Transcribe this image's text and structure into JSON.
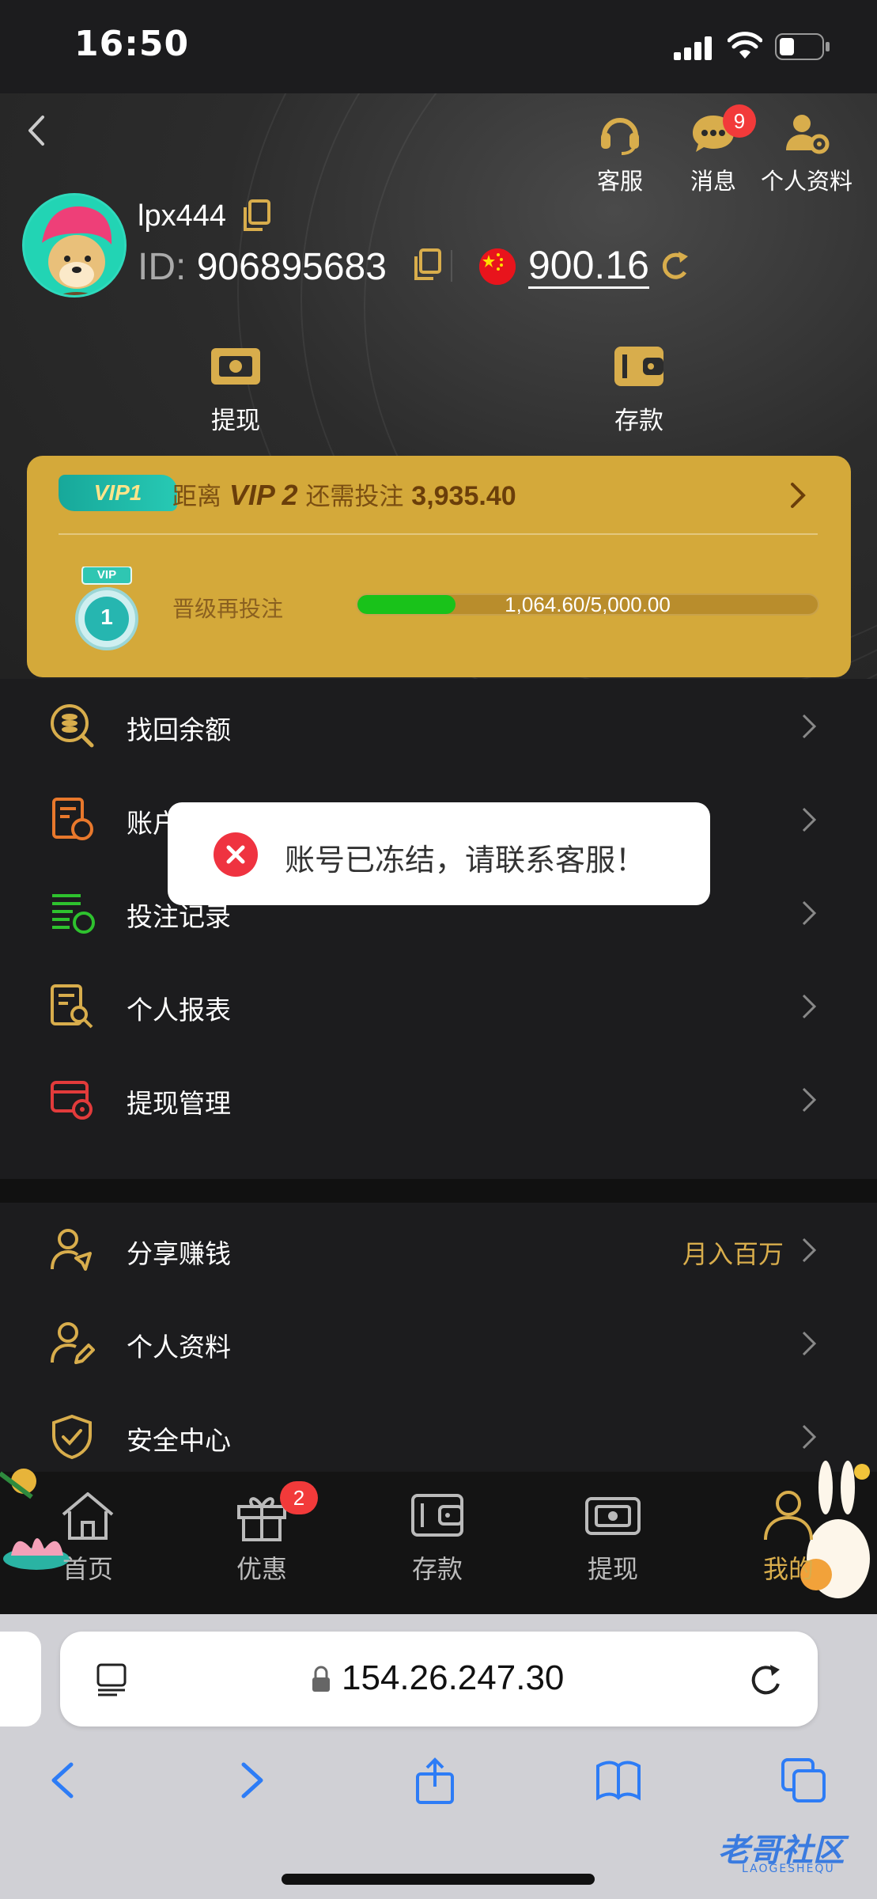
{
  "status": {
    "time": "16:50"
  },
  "header": {
    "actions": [
      {
        "label": "客服",
        "icon": "headset-icon"
      },
      {
        "label": "消息",
        "icon": "chat-icon",
        "badge": "9"
      },
      {
        "label": "个人资料",
        "icon": "user-settings-icon"
      }
    ],
    "username": "lpx444",
    "id_prefix": "ID:",
    "user_id": "906895683",
    "balance": "900.16",
    "quick_actions": [
      {
        "label": "提现",
        "icon": "withdraw-icon"
      },
      {
        "label": "存款",
        "icon": "wallet-icon"
      }
    ]
  },
  "vip": {
    "tag": "VIP1",
    "title_prefix": "距离",
    "next_level": "VIP 2",
    "title_mid": "还需投注",
    "amount": "3,935.40",
    "upgrade_label": "晋级再投注",
    "progress_text": "1,064.60/5,000.00",
    "progress_fraction": 0.2129,
    "medal_level": "1",
    "medal_tag": "VIP"
  },
  "menu": [
    {
      "label": "找回余额",
      "icon": "coin-search-icon"
    },
    {
      "label": "账户",
      "icon": "account-doc-icon"
    },
    {
      "label": "投注记录",
      "icon": "bet-record-icon"
    },
    {
      "label": "个人报表",
      "icon": "report-search-icon"
    },
    {
      "label": "提现管理",
      "icon": "withdraw-settings-icon"
    }
  ],
  "menu2": [
    {
      "label": "分享赚钱",
      "icon": "share-user-icon",
      "extra": "月入百万"
    },
    {
      "label": "个人资料",
      "icon": "user-edit-icon"
    },
    {
      "label": "安全中心",
      "icon": "shield-check-icon"
    }
  ],
  "toast": {
    "message": "账号已冻结，请联系客服！"
  },
  "tabs": [
    {
      "label": "首页",
      "icon": "home-icon"
    },
    {
      "label": "优惠",
      "icon": "gift-icon",
      "badge": "2"
    },
    {
      "label": "存款",
      "icon": "wallet-icon"
    },
    {
      "label": "提现",
      "icon": "withdraw-icon"
    },
    {
      "label": "我的",
      "icon": "user-icon",
      "active": true
    }
  ],
  "browser": {
    "url": "154.26.247.30"
  },
  "watermark": {
    "text": "老哥社区",
    "sub": "LAOGESHEQU"
  },
  "colors": {
    "gold": "#d8ad4c",
    "vip_card": "#d4a93a",
    "progress": "#19c21a",
    "error": "#ef3340"
  }
}
